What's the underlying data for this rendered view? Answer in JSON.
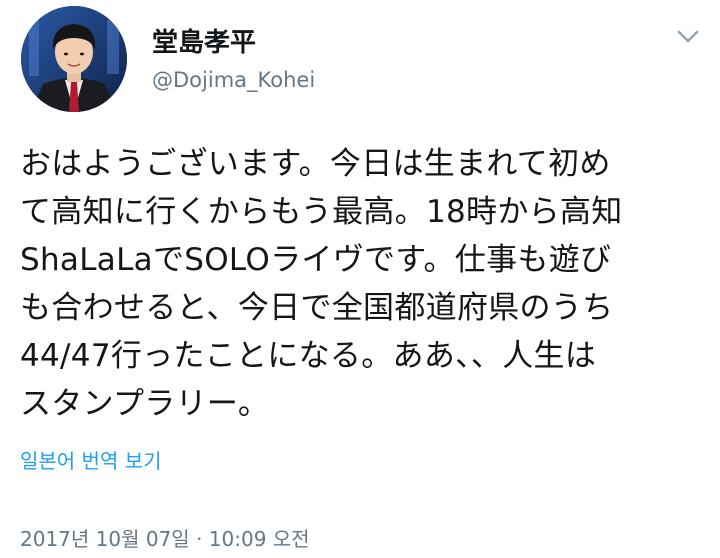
{
  "profile": {
    "display_name": "堂島孝平",
    "handle": "@Dojima_Kohei"
  },
  "tweet": {
    "lines": [
      "おはようございます。今日は生まれて初め",
      "て高知に行くからもう最高。18時から高知",
      "ShaLaLaでSOLOライヴです。仕事も遊び",
      "も合わせると、今日で全国都道府県のうち",
      "44/47行ったことになる。ああ、、人生は",
      "スタンプラリー。"
    ]
  },
  "translate": {
    "label": "일본어 번역 보기"
  },
  "meta": {
    "timestamp": "2017년 10월 07일 · 10:09 오전"
  },
  "icons": {
    "menu": "chevron-down-icon"
  },
  "colors": {
    "link": "#1da1f2",
    "secondary_text": "#657786",
    "primary_text": "#14171a"
  }
}
